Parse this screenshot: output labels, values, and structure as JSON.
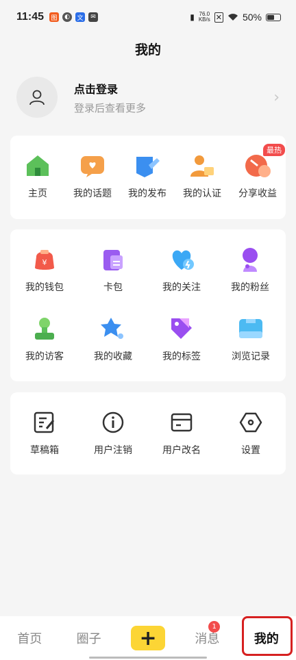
{
  "status": {
    "time": "11:45",
    "net_speed_value": "76.0",
    "net_speed_unit": "KB/s",
    "battery": "50%"
  },
  "page_title": "我的",
  "login": {
    "title": "点击登录",
    "subtitle": "登录后查看更多"
  },
  "quick_actions": [
    {
      "label": "主页",
      "icon": "home-icon"
    },
    {
      "label": "我的话题",
      "icon": "topic-icon"
    },
    {
      "label": "我的发布",
      "icon": "publish-icon"
    },
    {
      "label": "我的认证",
      "icon": "certify-icon"
    },
    {
      "label": "分享收益",
      "icon": "share-earnings-icon",
      "badge": "最热"
    }
  ],
  "features": [
    {
      "label": "我的钱包",
      "icon": "wallet-icon"
    },
    {
      "label": "卡包",
      "icon": "card-pack-icon"
    },
    {
      "label": "我的关注",
      "icon": "heart-icon"
    },
    {
      "label": "我的粉丝",
      "icon": "fans-icon"
    },
    {
      "label": "我的访客",
      "icon": "visitor-icon"
    },
    {
      "label": "我的收藏",
      "icon": "star-icon"
    },
    {
      "label": "我的标签",
      "icon": "tag-icon"
    },
    {
      "label": "浏览记录",
      "icon": "history-icon"
    }
  ],
  "settings": [
    {
      "label": "草稿箱",
      "icon": "draft-icon"
    },
    {
      "label": "用户注销",
      "icon": "info-icon"
    },
    {
      "label": "用户改名",
      "icon": "rename-card-icon"
    },
    {
      "label": "设置",
      "icon": "settings-hexagon-icon"
    }
  ],
  "tabbar": {
    "home": "首页",
    "circle": "圈子",
    "plus": "+",
    "messages": "消息",
    "messages_badge": "1",
    "mine": "我的"
  },
  "colors": {
    "accent": "#fcd535",
    "badge": "#f24c4c",
    "highlight": "#d62020"
  }
}
